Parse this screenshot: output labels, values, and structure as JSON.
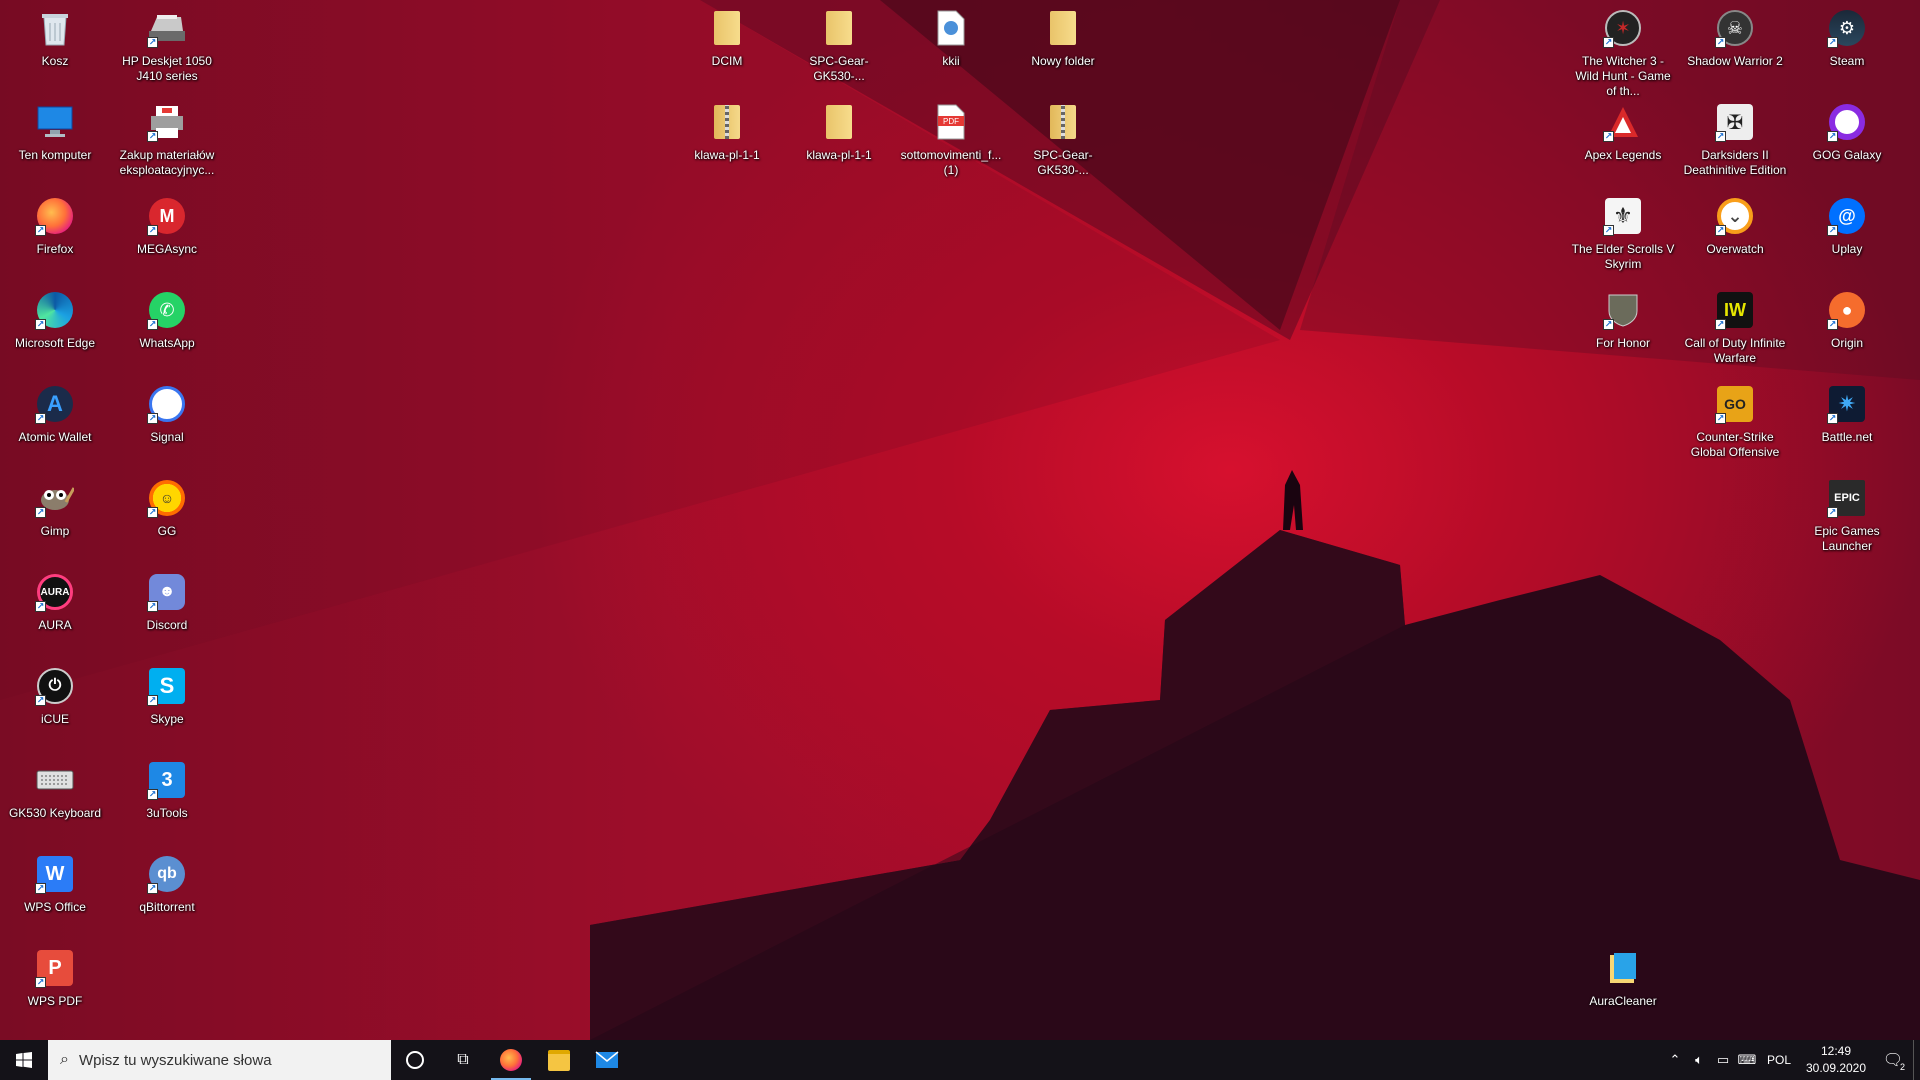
{
  "desktop_icons_left": [
    {
      "label": "Kosz",
      "icon": "recycle-bin-icon"
    },
    {
      "label": "HP Deskjet 1050 J410 series",
      "icon": "printer-icon"
    },
    {
      "label": "Ten komputer",
      "icon": "computer-icon"
    },
    {
      "label": "Zakup materiałów eksploatacyjnyc...",
      "icon": "printer-supplies-icon"
    },
    {
      "label": "Firefox",
      "icon": "firefox-icon"
    },
    {
      "label": "MEGAsync",
      "icon": "mega-icon"
    },
    {
      "label": "Microsoft Edge",
      "icon": "edge-icon"
    },
    {
      "label": "WhatsApp",
      "icon": "whatsapp-icon"
    },
    {
      "label": "Atomic Wallet",
      "icon": "atomic-wallet-icon"
    },
    {
      "label": "Signal",
      "icon": "signal-icon"
    },
    {
      "label": "Gimp",
      "icon": "gimp-icon"
    },
    {
      "label": "GG",
      "icon": "gg-icon"
    },
    {
      "label": "AURA",
      "icon": "aura-icon"
    },
    {
      "label": "Discord",
      "icon": "discord-icon"
    },
    {
      "label": "iCUE",
      "icon": "icue-icon"
    },
    {
      "label": "Skype",
      "icon": "skype-icon"
    },
    {
      "label": "GK530 Keyboard",
      "icon": "keyboard-icon"
    },
    {
      "label": "3uTools",
      "icon": "3utools-icon"
    },
    {
      "label": "WPS Office",
      "icon": "wps-office-icon"
    },
    {
      "label": "qBittorrent",
      "icon": "qbittorrent-icon"
    },
    {
      "label": "WPS PDF",
      "icon": "wps-pdf-icon"
    }
  ],
  "desktop_icons_center": [
    {
      "label": "DCIM",
      "icon": "folder-icon"
    },
    {
      "label": "SPC-Gear-GK530-...",
      "icon": "folder-icon"
    },
    {
      "label": "kkii",
      "icon": "document-icon"
    },
    {
      "label": "Nowy folder",
      "icon": "folder-icon"
    },
    {
      "label": "klawa-pl-1-1",
      "icon": "zip-folder-icon"
    },
    {
      "label": "klawa-pl-1-1",
      "icon": "folder-icon"
    },
    {
      "label": "sottomovimenti_f... (1)",
      "icon": "pdf-icon"
    },
    {
      "label": "SPC-Gear-GK530-...",
      "icon": "zip-folder-icon"
    }
  ],
  "desktop_icons_right": [
    {
      "label": "The Witcher 3 - Wild Hunt - Game of th...",
      "icon": "witcher-icon"
    },
    {
      "label": "Shadow Warrior 2",
      "icon": "shadow-warrior-icon"
    },
    {
      "label": "Steam",
      "icon": "steam-icon"
    },
    {
      "label": "Apex Legends",
      "icon": "apex-icon"
    },
    {
      "label": "Darksiders II Deathinitive Edition",
      "icon": "darksiders-icon"
    },
    {
      "label": "GOG Galaxy",
      "icon": "gog-icon"
    },
    {
      "label": "The Elder Scrolls V Skyrim",
      "icon": "skyrim-icon"
    },
    {
      "label": "Overwatch",
      "icon": "overwatch-icon"
    },
    {
      "label": "Uplay",
      "icon": "uplay-icon"
    },
    {
      "label": "For Honor",
      "icon": "for-honor-icon"
    },
    {
      "label": "Call of Duty Infinite Warfare",
      "icon": "cod-icon"
    },
    {
      "label": "Origin",
      "icon": "origin-icon"
    },
    {
      "label": "Counter-Strike Global Offensive",
      "icon": "csgo-icon"
    },
    {
      "label": "Battle.net",
      "icon": "battlenet-icon"
    },
    {
      "label": "Epic Games Launcher",
      "icon": "epic-games-icon"
    },
    {
      "label": "AuraCleaner",
      "icon": "auracleaner-icon"
    }
  ],
  "taskbar": {
    "search_placeholder": "Wpisz tu wyszukiwane słowa",
    "pinned": [
      "firefox-icon",
      "file-explorer-icon",
      "mail-icon"
    ],
    "tray": {
      "language": "POL",
      "time": "12:49",
      "date": "30.09.2020",
      "notification_count": "2"
    }
  },
  "colors": {
    "wallpaper_red": "#b70c28",
    "taskbar": "#141218",
    "search_box": "#f2f2f2",
    "active_indicator": "#76b9ed"
  }
}
